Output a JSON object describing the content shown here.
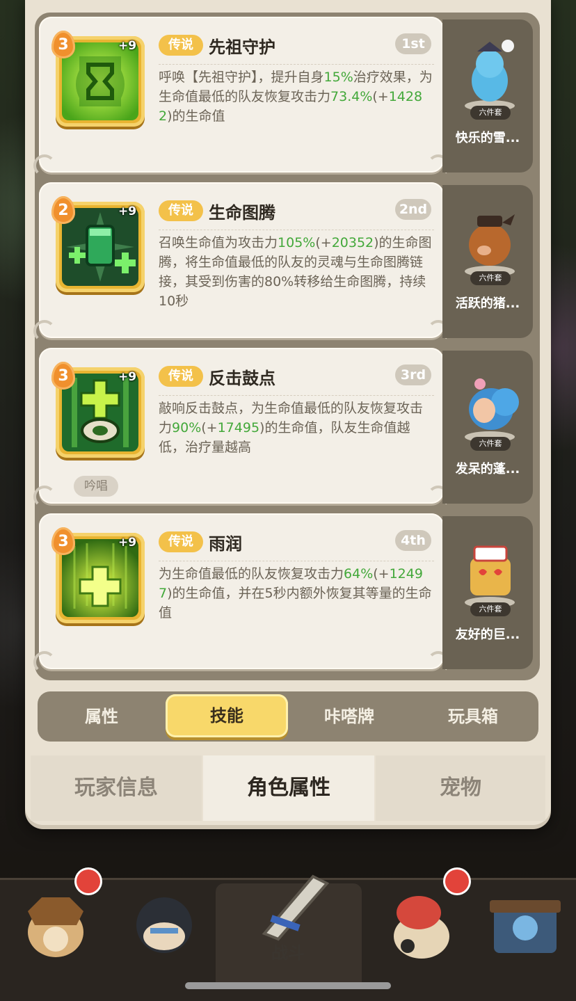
{
  "skills": [
    {
      "rank": "3",
      "level": "+9",
      "tag": "传说",
      "name": "先祖守护",
      "order": "1st",
      "desc_parts": [
        "呼唤【先祖守护】，提升自身",
        "15%",
        "治疗效果，为生命值最低的队友恢复攻击力",
        "73.4%",
        "(+",
        "14282",
        ")的生命值"
      ],
      "chant": "",
      "pet_name": "快乐的雪...",
      "pet_badge": "六件套"
    },
    {
      "rank": "2",
      "level": "+9",
      "tag": "传说",
      "name": "生命图腾",
      "order": "2nd",
      "desc_parts": [
        "召唤生命值为攻击力",
        "105%",
        "(+",
        "20352",
        ")的生命图腾，将生命值最低的队友的灵魂与生命图腾链接，其受到伤害的80%转移给生命图腾，持续10秒"
      ],
      "chant": "",
      "pet_name": "活跃的猪...",
      "pet_badge": "六件套"
    },
    {
      "rank": "3",
      "level": "+9",
      "tag": "传说",
      "name": "反击鼓点",
      "order": "3rd",
      "desc_parts": [
        "敲响反击鼓点，为生命值最低的队友恢复攻击力",
        "90%",
        "(+",
        "17495",
        ")的生命值，队友生命值越低，治疗量越高"
      ],
      "chant": "吟唱",
      "pet_name": "发呆的蓬...",
      "pet_badge": "六件套"
    },
    {
      "rank": "3",
      "level": "+9",
      "tag": "传说",
      "name": "雨润",
      "order": "4th",
      "desc_parts": [
        "为生命值最低的队友恢复攻击力",
        "64%",
        "(+",
        "12497",
        ")的生命值，并在5秒内额外恢复其等量的生命值"
      ],
      "chant": "",
      "pet_name": "友好的巨...",
      "pet_badge": "六件套"
    }
  ],
  "subtabs": [
    "属性",
    "技能",
    "咔嗒牌",
    "玩具箱"
  ],
  "subtab_active": "技能",
  "bottomtabs": [
    "玩家信息",
    "角色属性",
    "宠物"
  ],
  "bottomtab_active": "角色属性",
  "nav": {
    "battle_label": "战斗"
  },
  "colors": {
    "highlight": "#43a83a",
    "tag": "#f3c14a",
    "active_tab": "#f8d86a"
  }
}
